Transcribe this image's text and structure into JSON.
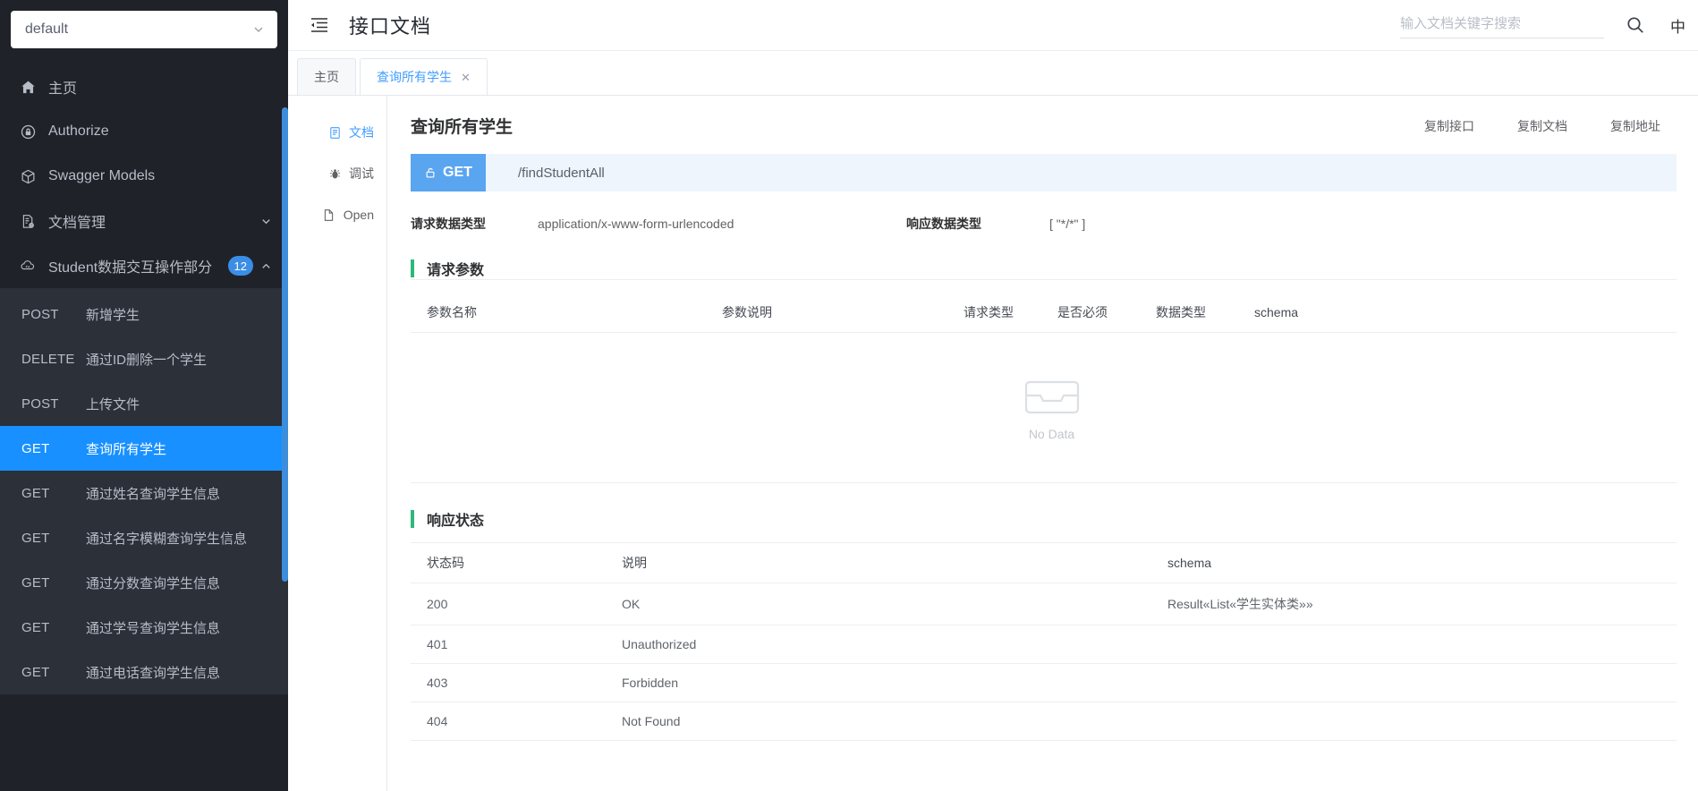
{
  "sidebar": {
    "select_value": "default",
    "chevron_icon": "chevron-down-icon",
    "menu": [
      {
        "label": "主页",
        "icon": "home-icon"
      },
      {
        "label": "Authorize",
        "icon": "lock-icon"
      },
      {
        "label": "Swagger Models",
        "icon": "cube-icon"
      },
      {
        "label": "文档管理",
        "icon": "document-settings-icon",
        "caret": "chevron-down-icon"
      }
    ],
    "group": {
      "label": "Student数据交互操作部分",
      "icon": "cloud-icon",
      "badge": "12",
      "caret": "chevron-up-icon"
    },
    "endpoints": [
      {
        "method": "POST",
        "name": "新增学生",
        "active": false
      },
      {
        "method": "DELETE",
        "name": "通过ID删除一个学生",
        "active": false
      },
      {
        "method": "POST",
        "name": "上传文件",
        "active": false
      },
      {
        "method": "GET",
        "name": "查询所有学生",
        "active": true
      },
      {
        "method": "GET",
        "name": "通过姓名查询学生信息",
        "active": false
      },
      {
        "method": "GET",
        "name": "通过名字模糊查询学生信息",
        "active": false
      },
      {
        "method": "GET",
        "name": "通过分数查询学生信息",
        "active": false
      },
      {
        "method": "GET",
        "name": "通过学号查询学生信息",
        "active": false
      },
      {
        "method": "GET",
        "name": "通过电话查询学生信息",
        "active": false
      }
    ]
  },
  "topbar": {
    "collapse_icon": "collapse-menu-icon",
    "title": "接口文档",
    "search_placeholder": "输入文档关键字搜索",
    "search_value": "",
    "search_icon": "search-icon",
    "lang_label": "中"
  },
  "tabs": [
    {
      "label": "主页",
      "active": false,
      "closable": false
    },
    {
      "label": "查询所有学生",
      "active": true,
      "closable": true,
      "close_label": "✕"
    }
  ],
  "vtabs": [
    {
      "label": "文档",
      "icon": "document-icon",
      "active": true
    },
    {
      "label": "调试",
      "icon": "bug-icon",
      "active": false
    },
    {
      "label": "Open",
      "icon": "file-icon",
      "active": false
    }
  ],
  "doc": {
    "title": "查询所有学生",
    "actions": [
      "复制接口",
      "复制文档",
      "复制地址"
    ],
    "method": "GET",
    "lock_icon": "unlock-icon",
    "path": "/findStudentAll",
    "request_type_label": "请求数据类型",
    "request_type_value": "application/x-www-form-urlencoded",
    "response_type_label": "响应数据类型",
    "response_type_value": "[ \"*/*\" ]",
    "params_section_title": "请求参数",
    "params_headers": [
      "参数名称",
      "参数说明",
      "请求类型",
      "是否必须",
      "数据类型",
      "schema"
    ],
    "params_rows": [],
    "no_data_text": "No Data",
    "no_data_icon": "empty-box-icon",
    "status_section_title": "响应状态",
    "status_headers": [
      "状态码",
      "说明",
      "schema"
    ],
    "status_rows": [
      {
        "code": "200",
        "desc": "OK",
        "schema": "Result«List«学生实体类»»"
      },
      {
        "code": "401",
        "desc": "Unauthorized",
        "schema": ""
      },
      {
        "code": "403",
        "desc": "Forbidden",
        "schema": ""
      },
      {
        "code": "404",
        "desc": "Not Found",
        "schema": ""
      }
    ]
  },
  "colors": {
    "sidebar_bg": "#20222a",
    "submenu_bg": "#2b3039",
    "active_blue": "#1890ff",
    "accent_green": "#2eb87a",
    "method_blue": "#5aa5f0"
  }
}
